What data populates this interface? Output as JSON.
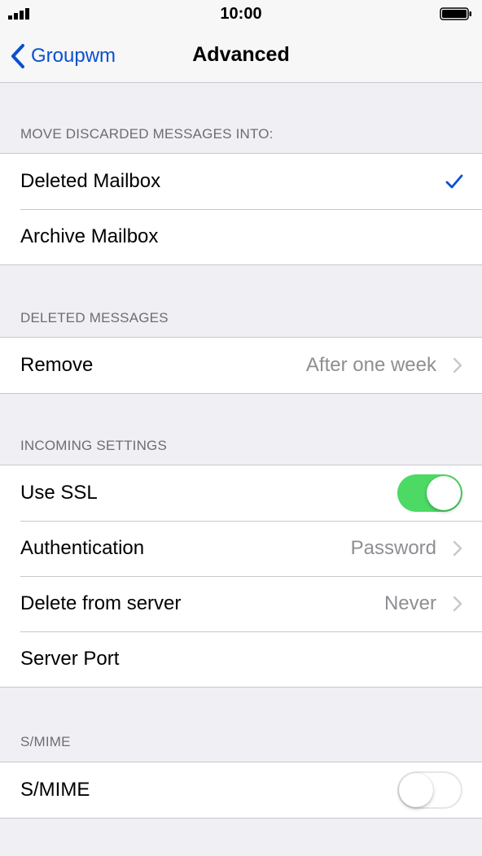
{
  "status_bar": {
    "time": "10:00"
  },
  "nav": {
    "back_label": "Groupwm",
    "title": "Advanced"
  },
  "sections": {
    "discarded": {
      "header": "MOVE DISCARDED MESSAGES INTO:",
      "rows": [
        {
          "label": "Deleted Mailbox",
          "selected": true
        },
        {
          "label": "Archive Mailbox",
          "selected": false
        }
      ]
    },
    "deleted": {
      "header": "DELETED MESSAGES",
      "rows": [
        {
          "label": "Remove",
          "value": "After one week"
        }
      ]
    },
    "incoming": {
      "header": "INCOMING SETTINGS",
      "rows": [
        {
          "label": "Use SSL",
          "toggle": true
        },
        {
          "label": "Authentication",
          "value": "Password"
        },
        {
          "label": "Delete from server",
          "value": "Never"
        },
        {
          "label": "Server Port",
          "value": ""
        }
      ]
    },
    "smime": {
      "header": "S/MIME",
      "rows": [
        {
          "label": "S/MIME",
          "toggle": false
        }
      ]
    }
  },
  "colors": {
    "accent": "#0a4fd1",
    "toggle_on": "#4cd964",
    "background": "#efeff4",
    "separator": "#c8c7cc",
    "secondary_text": "#8e8e93"
  },
  "icons": {
    "signal": "signal-bars-icon",
    "battery": "battery-icon",
    "back": "chevron-left-icon",
    "disclosure": "chevron-right-icon",
    "check": "checkmark-icon"
  }
}
